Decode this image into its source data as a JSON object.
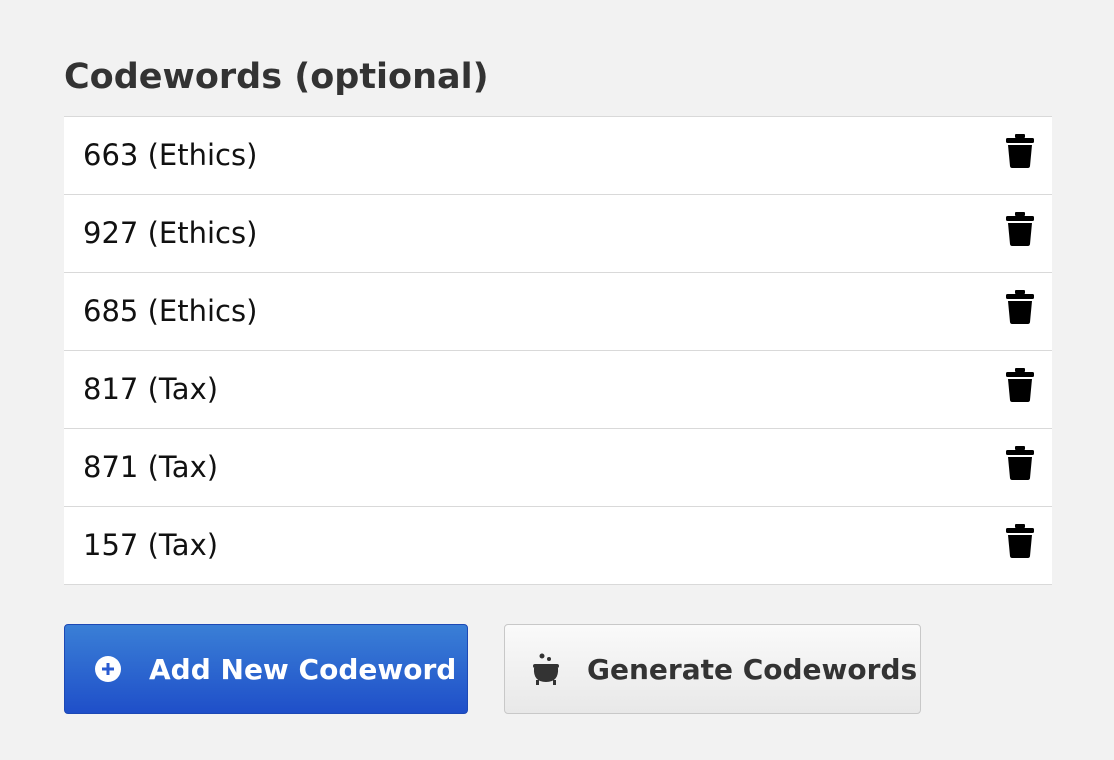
{
  "section": {
    "title": "Codewords (optional)"
  },
  "codewords": [
    {
      "label": "663 (Ethics)"
    },
    {
      "label": "927 (Ethics)"
    },
    {
      "label": "685 (Ethics)"
    },
    {
      "label": "817 (Tax)"
    },
    {
      "label": "871 (Tax)"
    },
    {
      "label": "157 (Tax)"
    }
  ],
  "actions": {
    "add_label": "Add New Codeword",
    "add_icon": "plus-circle-icon",
    "generate_label": "Generate Codewords",
    "generate_icon": "cauldron-icon"
  },
  "row_icon": "trash-icon",
  "colors": {
    "primary": "#2a63d0",
    "background": "#f2f2f2"
  }
}
